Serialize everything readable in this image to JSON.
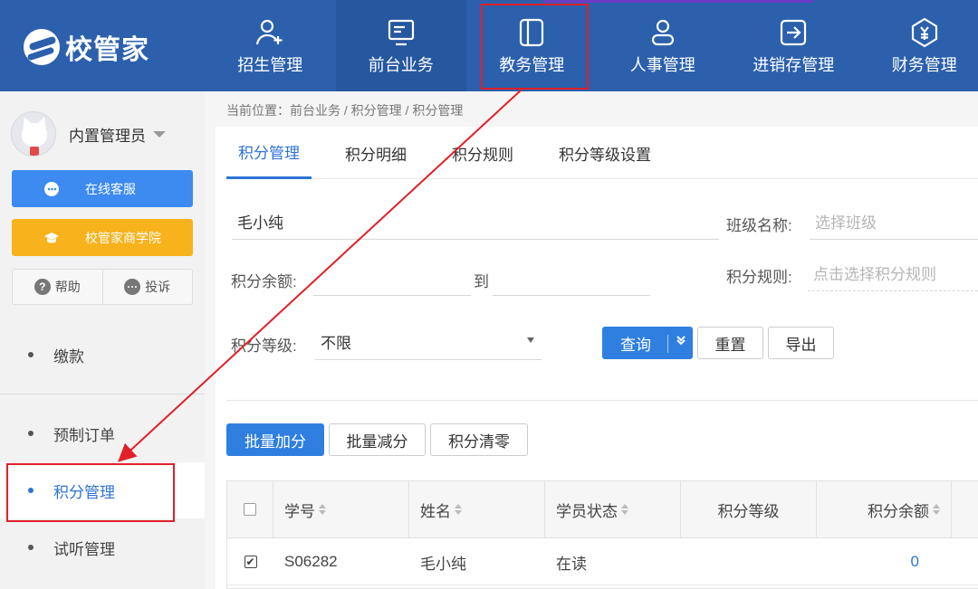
{
  "brand": {
    "name": "校管家"
  },
  "nav": {
    "items": [
      {
        "label": "招生管理",
        "icon": "user-add-icon"
      },
      {
        "label": "前台业务",
        "icon": "monitor-icon"
      },
      {
        "label": "教务管理",
        "icon": "book-panel-icon"
      },
      {
        "label": "人事管理",
        "icon": "person-icon"
      },
      {
        "label": "进销存管理",
        "icon": "inventory-icon"
      },
      {
        "label": "财务管理",
        "icon": "finance-icon"
      }
    ],
    "active": "前台业务"
  },
  "sidebar": {
    "user_name": "内置管理员",
    "online_service": "在线客服",
    "academy": "校管家商学院",
    "help": "帮助",
    "complaint": "投诉",
    "menu": [
      "缴款",
      "预制订单",
      "积分管理",
      "试听管理"
    ],
    "active_menu": "积分管理"
  },
  "breadcrumb": "当前位置：前台业务 / 积分管理 / 积分管理",
  "tabs": [
    "积分管理",
    "积分明细",
    "积分规则",
    "积分等级设置"
  ],
  "filters": {
    "name_value": "毛小纯",
    "class_label": "班级名称:",
    "class_placeholder": "选择班级",
    "balance_label": "积分余额:",
    "to_label": "到",
    "rule_label": "积分规则:",
    "rule_placeholder": "点击选择积分规则",
    "level_label": "积分等级:",
    "level_value": "不限"
  },
  "actions": {
    "query": "查询",
    "reset": "重置",
    "export": "导出",
    "batch_add": "批量加分",
    "batch_sub": "批量减分",
    "clear": "积分清零"
  },
  "table": {
    "headers": [
      "学号",
      "姓名",
      "学员状态",
      "积分等级",
      "积分余额"
    ],
    "rows": [
      {
        "id": "S06282",
        "name": "毛小纯",
        "status": "在读",
        "level": "",
        "balance": "0",
        "checked": true
      }
    ]
  },
  "colors": {
    "nav_bg": "#2c60ad",
    "accent": "#2f73d6",
    "annotation": "#e0202a"
  }
}
